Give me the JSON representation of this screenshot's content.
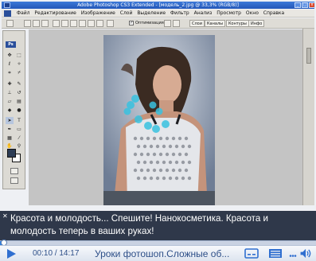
{
  "photoshop": {
    "window_title": "Adobe Photoshop CS3 Extended - [модель_2.jpg @ 33,3% (RGB/8)]",
    "menu": [
      "Файл",
      "Редактирование",
      "Изображение",
      "Слой",
      "Выделение",
      "Фильтр",
      "Анализ",
      "Просмотр",
      "Окно",
      "Справка"
    ],
    "options_bar": {
      "antialias_label": "Оптимизация",
      "panel_tabs": [
        "Слои",
        "Каналы",
        "Контуры",
        "Инфо"
      ]
    },
    "toolbox": {
      "badge": "Ps",
      "text_tool_glyph": "T",
      "colors": {
        "foreground": "#2d3d55",
        "background": "#ffffff"
      }
    }
  },
  "subtitle": {
    "close_glyph": "✕",
    "text": "Красота и молодость... Спешите! Нанокосметика. Красота и молодость теперь в ваших руках!"
  },
  "player": {
    "current_time": "00:10",
    "total_time": "14:17",
    "progress": 0.012,
    "video_title": "Уроки фотошоп.Сложные об..."
  },
  "icons": {
    "play": "play-icon",
    "subtitles": "subtitles-icon",
    "hd": "hd-icon",
    "more": "more-icon",
    "volume": "volume-icon"
  },
  "colors": {
    "player_accent": "#2f6fd0",
    "titlebar": "#2357b8",
    "subtitle_bg": "#141e32"
  }
}
